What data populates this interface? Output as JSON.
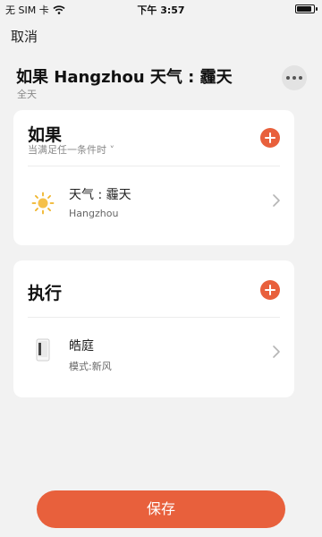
{
  "status_bar": {
    "carrier": "无 SIM 卡",
    "time": "下午 3:57",
    "battery_level": 0.9
  },
  "nav": {
    "cancel_label": "取消"
  },
  "header": {
    "title": "如果 Hangzhou 天气 : 霾天",
    "subtitle": "全天"
  },
  "if_card": {
    "heading": "如果",
    "hint": "当满足任一条件时 ˅",
    "items": [
      {
        "title": "天气 : 霾天",
        "subtitle": "Hangzhou",
        "icon": "sun-haze-icon"
      }
    ]
  },
  "do_card": {
    "heading": "执行",
    "items": [
      {
        "title": "皓庭",
        "subtitle": "模式:新风",
        "icon": "air-purifier-icon"
      }
    ]
  },
  "footer": {
    "save_label": "保存"
  },
  "colors": {
    "accent": "#e8603c",
    "background": "#f2f2f2",
    "card": "#ffffff"
  }
}
